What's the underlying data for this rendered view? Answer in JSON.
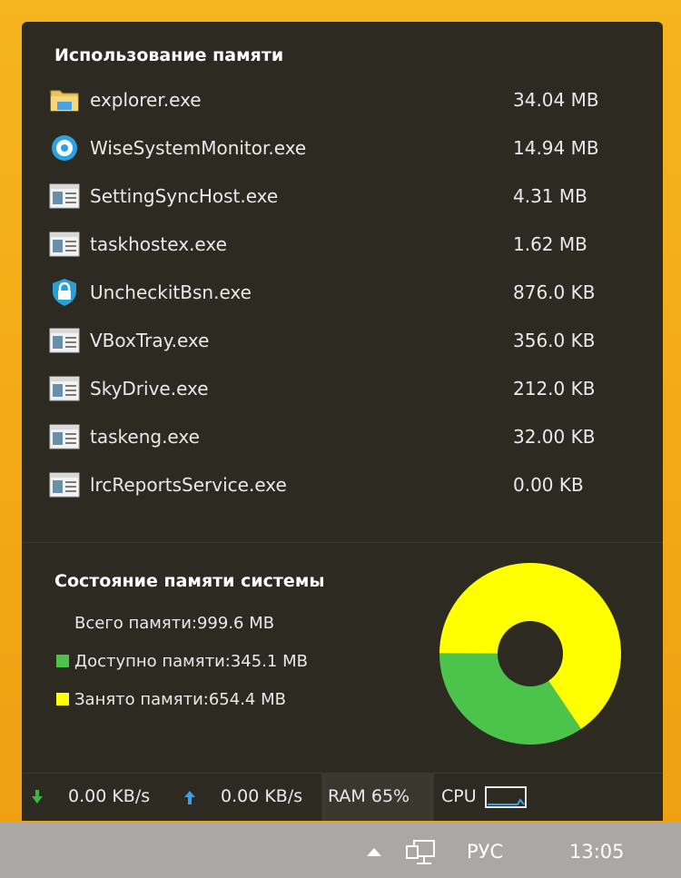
{
  "memory_usage": {
    "title": "Использование памяти",
    "processes": [
      {
        "name": "explorer.exe",
        "size": "34.04 MB",
        "icon": "folder-icon"
      },
      {
        "name": "WiseSystemMonitor.exe",
        "size": "14.94 MB",
        "icon": "wise-monitor-icon"
      },
      {
        "name": "SettingSyncHost.exe",
        "size": "4.31 MB",
        "icon": "app-window-icon"
      },
      {
        "name": "taskhostex.exe",
        "size": "1.62 MB",
        "icon": "app-window-icon"
      },
      {
        "name": "UncheckitBsn.exe",
        "size": "876.0 KB",
        "icon": "shield-lock-icon"
      },
      {
        "name": "VBoxTray.exe",
        "size": "356.0 KB",
        "icon": "app-window-icon"
      },
      {
        "name": "SkyDrive.exe",
        "size": "212.0 KB",
        "icon": "app-window-icon"
      },
      {
        "name": "taskeng.exe",
        "size": "32.00 KB",
        "icon": "app-window-icon"
      },
      {
        "name": "lrcReportsService.exe",
        "size": "0.00 KB",
        "icon": "app-window-icon"
      }
    ]
  },
  "system_memory": {
    "title": "Состояние памяти системы",
    "total": "Всего памяти:999.6 MB",
    "available": "Доступно памяти:345.1 MB",
    "used": "Занято памяти:654.4 MB",
    "available_fraction": 0.345,
    "used_fraction": 0.655,
    "colors": {
      "available": "#4cc34a",
      "used": "#ffff00"
    }
  },
  "status_bar": {
    "download": "0.00 KB/s",
    "upload": "0.00 KB/s",
    "ram": "RAM 65%",
    "cpu_label": "CPU",
    "download_color": "#3db83d",
    "upload_color": "#3a9ee8"
  },
  "taskbar": {
    "language": "РУС",
    "time": "13:05"
  }
}
